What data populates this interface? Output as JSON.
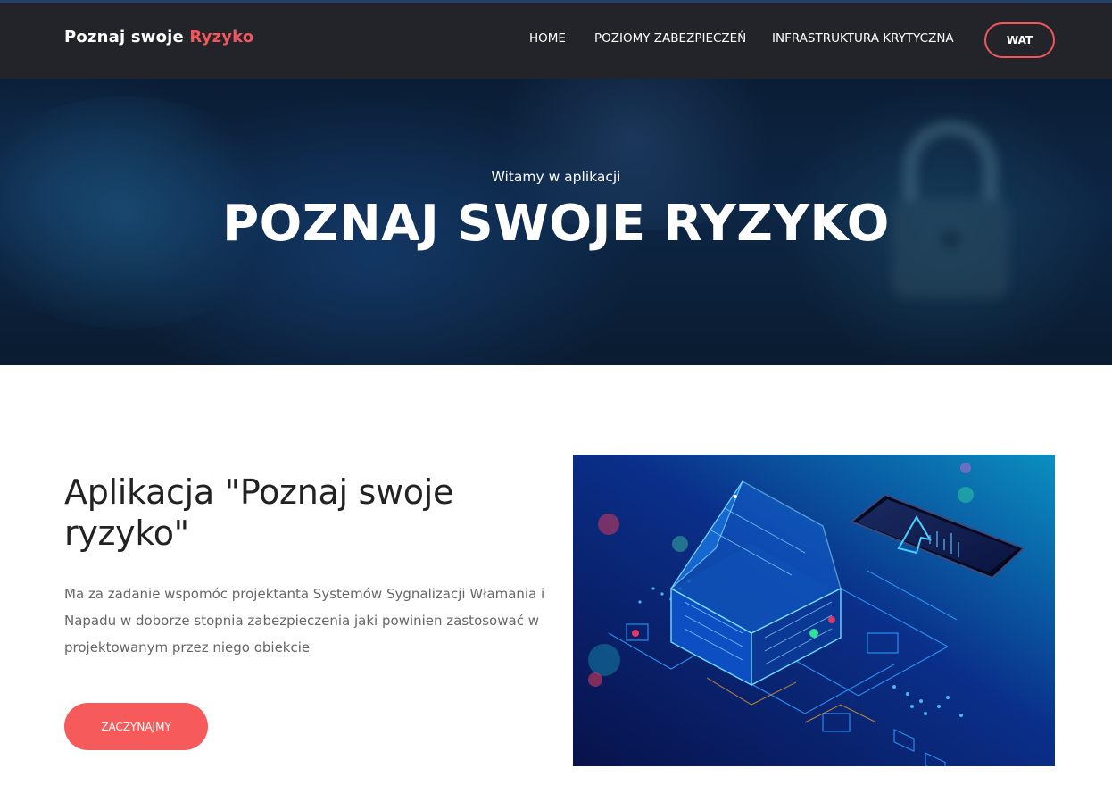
{
  "navbar": {
    "brand_main": "Poznaj swoje",
    "brand_accent": "Ryzyko",
    "links": [
      {
        "label": "HOME"
      },
      {
        "label": "POZIOMY ZABEZPIECZEŃ"
      },
      {
        "label": "INFRASTRUKTURA KRYTYCZNA"
      }
    ],
    "cta_label": "WAT"
  },
  "hero": {
    "subtitle": "Witamy w aplikacji",
    "title": "POZNAJ SWOJE RYZYKO"
  },
  "about": {
    "title": "Aplikacja \"Poznaj swoje ryzyko\"",
    "text": "Ma za zadanie wspomóc projektanta Systemów Sygnalizacji Włamania i Napadu w doborze stopnia zabezpieczenia jaki powinien zastosować w projektowanym przez niego obiekcie",
    "button_label": "ZACZYNAJMY"
  },
  "colors": {
    "accent": "#f65a5b",
    "navbar_bg": "#232429",
    "hero_bg": "#0d2645"
  },
  "icons": {
    "hero_background": "padlock-cyber-background",
    "illustration": "smart-home-phone-illustration"
  }
}
